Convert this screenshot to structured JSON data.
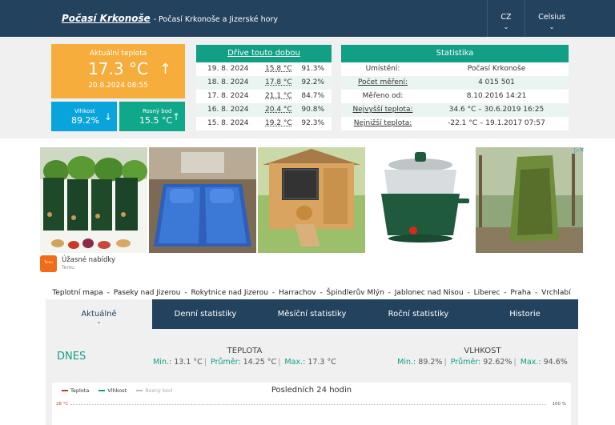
{
  "header": {
    "title": "Počasí Krkonoše",
    "subtitle": "- Počasí Krkonoše a Jizerské hory",
    "language": "CZ",
    "unit": "Celsius"
  },
  "current": {
    "label": "Aktuální teplota",
    "temperature": "17.3 °C",
    "trend_icon": "arrow-up",
    "datetime": "20.8.2024 08:55"
  },
  "humidity_box": {
    "label": "Vlhkost",
    "value": "89.2%",
    "trend_icon": "arrow-down"
  },
  "dew_box": {
    "label": "Rosný bod",
    "value": "15.5 °C",
    "trend_icon": "arrow-up"
  },
  "history": {
    "heading": "Dříve touto dobou",
    "rows": [
      {
        "date": "19. 8. 2024",
        "temp": "15.8 °C",
        "hum": "91.3%"
      },
      {
        "date": "18. 8. 2024",
        "temp": "17.8 °C",
        "hum": "92.2%"
      },
      {
        "date": "17. 8. 2024",
        "temp": "21.1 °C",
        "hum": "84.7%"
      },
      {
        "date": "16. 8. 2024",
        "temp": "20.4 °C",
        "hum": "90.8%"
      },
      {
        "date": "15. 8. 2024",
        "temp": "19.2 °C",
        "hum": "92.3%"
      }
    ]
  },
  "stats": {
    "heading": "Statistika",
    "rows": [
      {
        "key": "Umístění:",
        "value": "Počasí Krkonoše"
      },
      {
        "key": "Počet měření:",
        "value": "4 015 501"
      },
      {
        "key": "Měřeno od:",
        "value": "8.10.2016 14:21"
      },
      {
        "key": "Nejvyšší teplota:",
        "value": "34.6 °C – 30.6.2019 16:25"
      },
      {
        "key": "Nejnižší teplota:",
        "value": "-22.1 °C – 19.1.2017 07:57"
      }
    ]
  },
  "ad": {
    "title": "Úžasné nabídky",
    "brand": "Temu",
    "logo_text": "Temu",
    "choices_icon": "adchoices-icon",
    "tiles": [
      "grow-bags",
      "car-air-mattress",
      "chicken-coop",
      "electric-steamer-pot",
      "pop-up-tent"
    ]
  },
  "links": [
    "Teplotní mapa",
    "Paseky nad Jizerou",
    "Rokytnice nad Jizerou",
    "Harrachov",
    "Špindlerův Mlýn",
    "Jablonec nad Nisou",
    "Liberec",
    "Praha",
    "Vrchlabí"
  ],
  "tabs": [
    "Aktuálně",
    "Denní statistiky",
    "Měsíční statistiky",
    "Roční statistiky",
    "Historie"
  ],
  "today": {
    "label": "DNES",
    "temp": {
      "title": "TEPLOTA",
      "min_label": "Min.:",
      "min": "13.1 °C",
      "avg_label": "Průměr:",
      "avg": "14.25 °C",
      "max_label": "Max.:",
      "max": "17.3 °C"
    },
    "hum": {
      "title": "VLHKOST",
      "min_label": "Min.:",
      "min": "89.2%",
      "avg_label": "Průměr:",
      "avg": "92.62%",
      "max_label": "Max.:",
      "max": "94.6%"
    }
  },
  "chart": {
    "title": "Posledních 24 hodin",
    "legend": [
      {
        "name": "Teplota",
        "color": "#c0392b"
      },
      {
        "name": "Vlhkost",
        "color": "#119f86"
      },
      {
        "name": "Rosný bod",
        "color": "#bbbbbb"
      }
    ],
    "y_left_top": "28 °C",
    "y_right_top": "100 %"
  }
}
